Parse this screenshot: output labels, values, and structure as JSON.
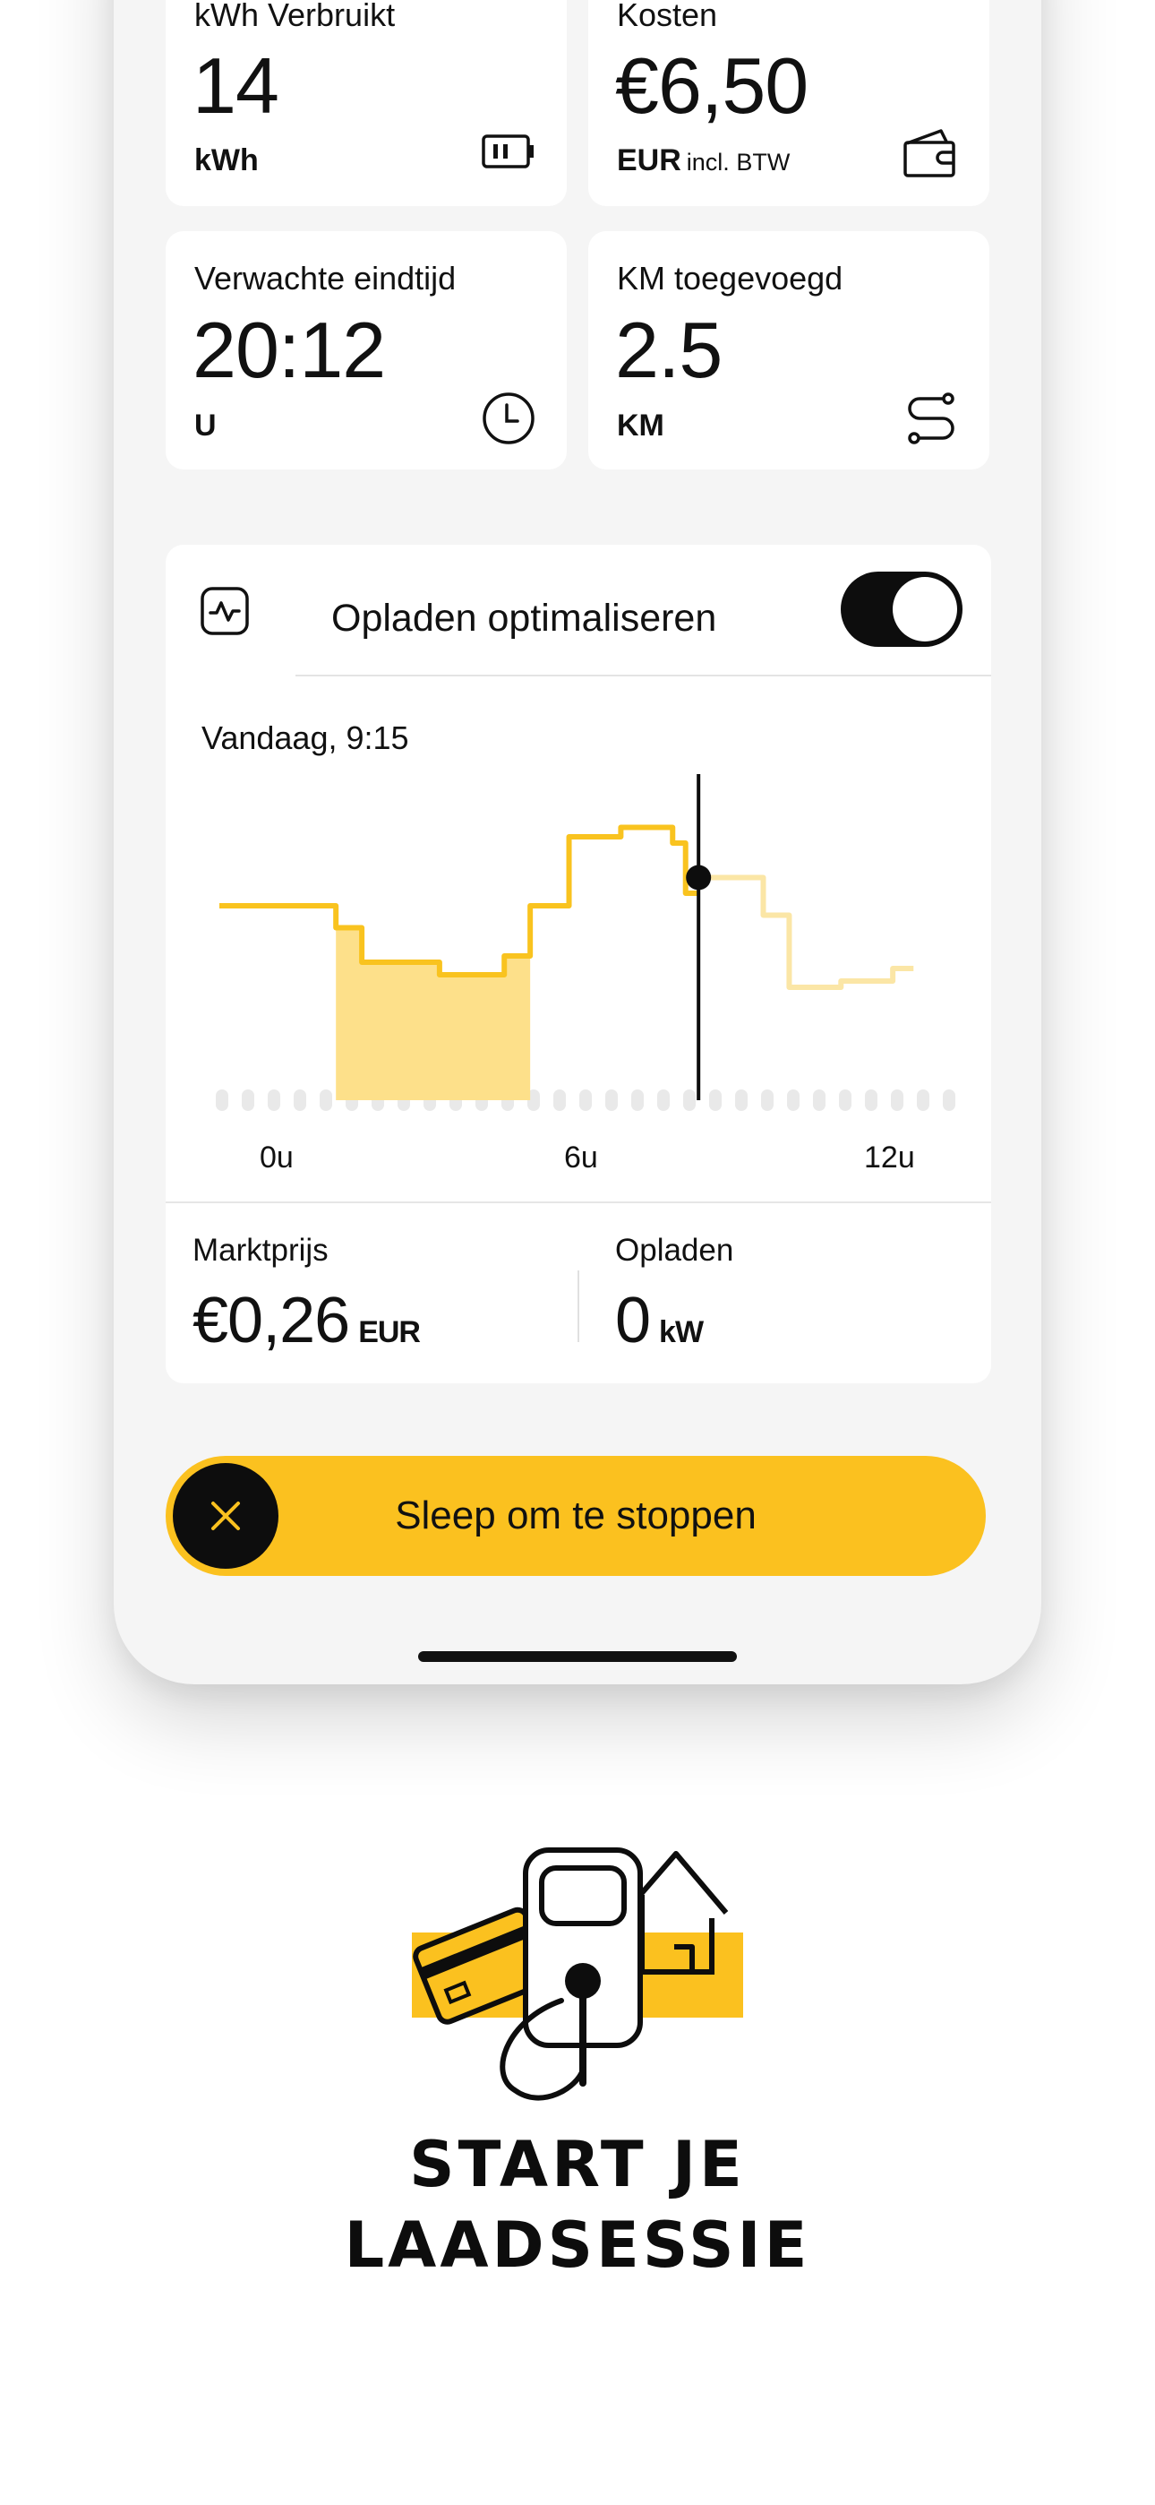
{
  "stats": [
    {
      "label": "kWh Verbruikt",
      "value": "14",
      "unit": "kWh",
      "unit_note": "",
      "icon": "battery-icon"
    },
    {
      "label": "Kosten",
      "value": "€6,50",
      "unit": "EUR",
      "unit_note": "incl. BTW",
      "icon": "wallet-icon"
    },
    {
      "label": "Verwachte eindtijd",
      "value": "20:12",
      "unit": "U",
      "unit_note": "",
      "icon": "clock-icon"
    },
    {
      "label": "KM toegevoegd",
      "value": "2.5",
      "unit": "KM",
      "unit_note": "",
      "icon": "route-icon"
    }
  ],
  "optimize": {
    "title": "Opladen optimaliseren",
    "toggle_on": true,
    "icon": "activity-icon"
  },
  "chart_data": {
    "type": "line",
    "title": "Vandaag, 9:15",
    "xlabel": "",
    "ylabel": "",
    "x_ticks": [
      "0u",
      "6u",
      "12u"
    ],
    "xlim": [
      0,
      14
    ],
    "ylim": [
      0,
      1
    ],
    "current_x": 9.25,
    "charging_window": [
      2.25,
      6.0
    ],
    "series": [
      {
        "style": "step",
        "x": [
          0,
          2.25,
          2.75,
          4.25,
          5.5,
          6.0,
          6.75,
          7.75,
          8.75,
          9.0,
          9.25,
          10.0,
          10.5,
          11.0,
          12.0,
          13.0
        ],
        "values": [
          0.62,
          0.55,
          0.44,
          0.4,
          0.46,
          0.62,
          0.84,
          0.87,
          0.82,
          0.66,
          0.71,
          0.71,
          0.59,
          0.36,
          0.38,
          0.42
        ]
      }
    ],
    "colors": {
      "line": "#f9c31f",
      "future_line": "#fbe6a6",
      "fill": "#fde08a",
      "marker": "#0d0d0d",
      "axis_dots": "#e9e9e9"
    }
  },
  "footer": {
    "price_label": "Marktprijs",
    "price_value": "€0,26",
    "price_unit": "EUR",
    "power_label": "Opladen",
    "power_value": "0",
    "power_unit": "kW"
  },
  "slider": {
    "label": "Sleep om te stoppen",
    "icon": "close-icon"
  },
  "promo": {
    "line1": "START JE",
    "line2": "LAADSESSIE",
    "illustration": "charging-station-illustration"
  },
  "colors": {
    "accent": "#fbc11f",
    "dark": "#0d0d0d",
    "panel_bg": "#f5f5f5"
  }
}
